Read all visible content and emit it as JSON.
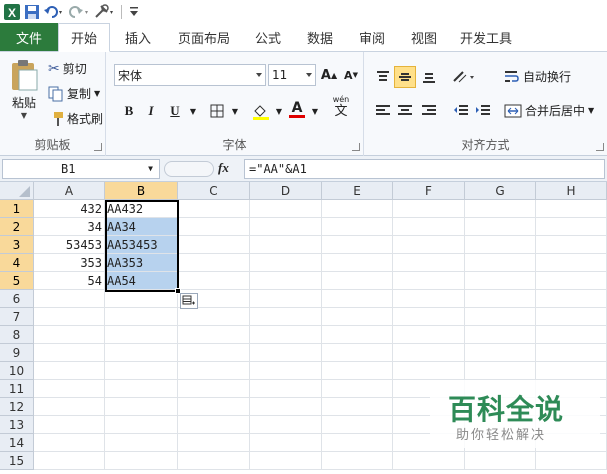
{
  "qat": {
    "icons": [
      "excel-app-icon",
      "save-icon",
      "undo-icon",
      "redo-icon",
      "customize-icon"
    ]
  },
  "tabs": [
    {
      "label": "文件"
    },
    {
      "label": "开始"
    },
    {
      "label": "插入"
    },
    {
      "label": "页面布局"
    },
    {
      "label": "公式"
    },
    {
      "label": "数据"
    },
    {
      "label": "审阅"
    },
    {
      "label": "视图"
    },
    {
      "label": "开发工具"
    }
  ],
  "clipboard": {
    "paste": "粘贴",
    "cut": "剪切",
    "copy": "复制",
    "format_painter": "格式刷",
    "group": "剪贴板"
  },
  "font": {
    "name": "宋体",
    "size": "11",
    "bold": "B",
    "italic": "I",
    "underline": "U",
    "font_color": "A",
    "wen": "wén",
    "wen_char": "文",
    "group": "字体"
  },
  "alignment": {
    "wrap": "自动换行",
    "merge": "合并后居中",
    "group": "对齐方式"
  },
  "formula_bar": {
    "name_box": "B1",
    "fx": "fx",
    "formula": "=\"AA\"&A1"
  },
  "sheet": {
    "columns": [
      "A",
      "B",
      "C",
      "D",
      "E",
      "F",
      "G",
      "H"
    ],
    "rows": [
      "1",
      "2",
      "3",
      "4",
      "5",
      "6",
      "7",
      "8",
      "9",
      "10",
      "11",
      "12",
      "13",
      "14",
      "15"
    ],
    "colA": [
      "432",
      "34",
      "53453",
      "353",
      "54"
    ],
    "colB": [
      "AA432",
      "AA34",
      "AA53453",
      "AA353",
      "AA54"
    ]
  },
  "watermark": {
    "title": "百科全说",
    "subtitle": "助你轻松解决"
  }
}
